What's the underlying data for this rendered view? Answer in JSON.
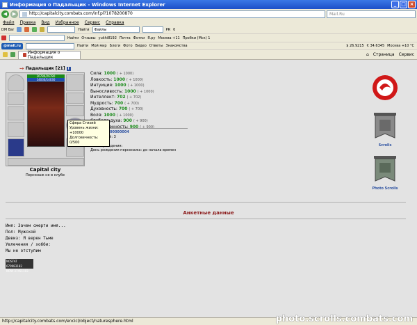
{
  "window": {
    "title": "Информация о Падальщик - Windows Internet Explorer",
    "min": "_",
    "max": "□",
    "close": "×"
  },
  "address": {
    "url": "http://capitalcity.combats.com/inf.pl?1078200870",
    "search_placeholder": "Mail.Ru"
  },
  "menu": [
    "Файл",
    "Правка",
    "Вид",
    "Избранное",
    "Сервис",
    "Справка"
  ],
  "toolbar1": {
    "brand": "DM Bar",
    "search_label": "Найти",
    "files": "Файлы",
    "go": "PR",
    "counter": "0"
  },
  "toolbar2": {
    "reviews": "Отзывы",
    "user": "yukhi8192",
    "mail": "Почта",
    "photos": "Фотки",
    "yaru": "Я.ру",
    "weather": "Москва +11",
    "traffic": "Пробки (Мск) 1"
  },
  "toolbar3": {
    "brand": "@mail.ru",
    "find": "Найти",
    "myworld": "Мой мир",
    "blogs": "Блоги",
    "photo": "Фото",
    "video": "Видео",
    "answers": "Ответы",
    "dating": "Знакомства",
    "usd": "$ 26.9215",
    "eur": "€ 34.6345",
    "weather": "Москва +10 °C"
  },
  "tabbar": {
    "tab_label": "Информация о Падальщик",
    "page": "Страница",
    "tools": "Сервис"
  },
  "character": {
    "name": "Падальщик",
    "level": "[21]",
    "hp": "26780/26780",
    "mana": "14030/14030",
    "city": "Capital city",
    "clan": "Персонаж не в клубе"
  },
  "stats": [
    {
      "label": "Сила:",
      "value": "1000",
      "bonus": "( + 1000)"
    },
    {
      "label": "Ловкость:",
      "value": "1000",
      "bonus": "( + 1000)"
    },
    {
      "label": "Интуиция:",
      "value": "1000",
      "bonus": "( + 1000)"
    },
    {
      "label": "Выносливость:",
      "value": "1000",
      "bonus": "( + 1000)"
    },
    {
      "label": "Интеллект:",
      "value": "702",
      "bonus": "( + 702)"
    },
    {
      "label": "Мудрость:",
      "value": "700",
      "bonus": "( + 700)"
    },
    {
      "label": "Духовность:",
      "value": "700",
      "bonus": "( + 700)"
    },
    {
      "label": "Воля:",
      "value": "1000",
      "bonus": "( + 1000)"
    },
    {
      "label": "Свобода духа:",
      "value": "900",
      "bonus": "( + 900)"
    },
    {
      "label": "Божественность:",
      "value": "900",
      "bonus": "( + 900)"
    }
  ],
  "tooltip": {
    "line1": "Сфера Стихий",
    "line2": "Уровень жизни: +10000",
    "line3": "Долговечность: 0/500"
  },
  "extra": {
    "exp": "00000004",
    "losses": "Поражений: 3",
    "draws": "Ничьих: 0",
    "birthplace": "Место рождения:",
    "birthday": "День рождения персонажа: до начала времен"
  },
  "badges": {
    "scrolls": "Scrolls",
    "photo_scrolls": "Photo Scrolls"
  },
  "section_title": "Анкетные данные",
  "anketa": {
    "name": "Имя: Зачем смерти имя...",
    "sex": "Пол: Мужской",
    "motto": "Девиз: Я верен Тьме",
    "hobby": "Увлечения / хобби:",
    "hobby2": "Мы не отступим"
  },
  "counter": {
    "l1": "NOSTAT 679983182",
    "l2": "NOW 37451103",
    "l3": "5283"
  },
  "status": {
    "url": "http://capitalcity.combats.com/encicl/object/naturesphere.html",
    "watermark": "photo.scrolls.combats.com"
  }
}
